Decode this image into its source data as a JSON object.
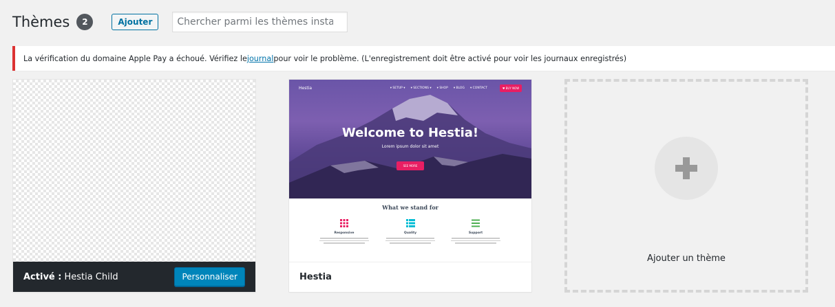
{
  "header": {
    "title": "Thèmes",
    "count": "2",
    "add_label": "Ajouter",
    "search_placeholder": "Chercher parmi les thèmes installés..."
  },
  "notice": {
    "text_before": "La vérification du domaine Apple Pay a échoué. Vérifiez le ",
    "link": "journal ",
    "text_after": "pour voir le problème. (L'enregistrement doit être activé pour voir les journaux enregistrés)",
    "border_color": "#dc3232"
  },
  "themes": [
    {
      "active_label": "Activé :",
      "name": "Hestia Child",
      "customize_label": "Personnaliser"
    },
    {
      "name": "Hestia",
      "preview": {
        "logo": "Hestia",
        "menu": [
          "▾ SETUP ▾",
          "▾ SECTIONS ▾",
          "▾ SHOP",
          "▾ BLOG",
          "▾ CONTACT"
        ],
        "buy_label": "♥ BUY NOW",
        "title": "Welcome to Hestia!",
        "subtitle": "Lorem ipsum dolor sit amet",
        "button": "SEE MORE",
        "features_title": "What we stand for",
        "features": [
          {
            "name": "Responsive",
            "icon": "grid-icon",
            "color": "#e91e63"
          },
          {
            "name": "Quality",
            "icon": "table-icon",
            "color": "#00bcd4"
          },
          {
            "name": "Support",
            "icon": "menu-icon",
            "color": "#4caf50"
          }
        ]
      }
    }
  ],
  "add_new_theme": {
    "label": "Ajouter un thème",
    "icon": "plus-icon"
  },
  "colors": {
    "accent": "#0085ba",
    "link": "#0073aa",
    "active_footer": "#23282d"
  }
}
